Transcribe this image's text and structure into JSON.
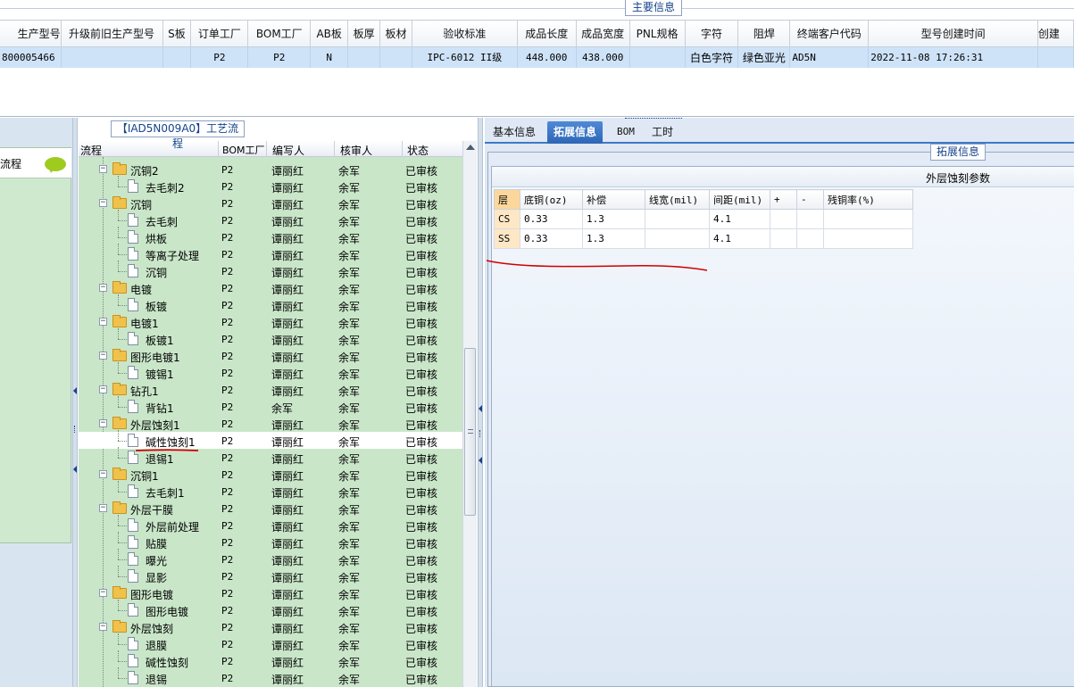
{
  "main_info": {
    "title": "主要信息",
    "columns": [
      "生产型号",
      "升级前旧生产型号",
      "S板",
      "订单工厂",
      "BOM工厂",
      "AB板",
      "板厚",
      "板材",
      "验收标准",
      "成品长度",
      "成品宽度",
      "PNL规格",
      "字符",
      "阻焊",
      "终端客户代码",
      "型号创建时间",
      "创建"
    ],
    "row": [
      "800005466",
      "",
      "",
      "P2",
      "P2",
      "N",
      "",
      "",
      "IPC-6012 II级",
      "448.000",
      "438.000",
      "",
      "白色字符",
      "绿色亚光",
      "AD5N",
      "2022-11-08 17:26:31",
      ""
    ]
  },
  "left_sidebar": {
    "item_label": "流程"
  },
  "process_tree": {
    "title": "【IAD5N009A0】工艺流程",
    "headers": [
      "流程",
      "BOM工厂",
      "编写人",
      "核审人",
      "状态"
    ],
    "rows": [
      {
        "label": "沉铜2",
        "type": "folder",
        "bom": "P2",
        "writer": "谭丽红",
        "reviewer": "余军",
        "status": "已审核"
      },
      {
        "label": "去毛刺2",
        "type": "doc",
        "bom": "P2",
        "writer": "谭丽红",
        "reviewer": "余军",
        "status": "已审核"
      },
      {
        "label": "沉铜",
        "type": "folder",
        "bom": "P2",
        "writer": "谭丽红",
        "reviewer": "余军",
        "status": "已审核"
      },
      {
        "label": "去毛刺",
        "type": "doc",
        "bom": "P2",
        "writer": "谭丽红",
        "reviewer": "余军",
        "status": "已审核"
      },
      {
        "label": "烘板",
        "type": "doc",
        "bom": "P2",
        "writer": "谭丽红",
        "reviewer": "余军",
        "status": "已审核"
      },
      {
        "label": "等离子处理",
        "type": "doc",
        "bom": "P2",
        "writer": "谭丽红",
        "reviewer": "余军",
        "status": "已审核"
      },
      {
        "label": "沉铜",
        "type": "doc",
        "bom": "P2",
        "writer": "谭丽红",
        "reviewer": "余军",
        "status": "已审核"
      },
      {
        "label": "电镀",
        "type": "folder",
        "bom": "P2",
        "writer": "谭丽红",
        "reviewer": "余军",
        "status": "已审核"
      },
      {
        "label": "板镀",
        "type": "doc",
        "bom": "P2",
        "writer": "谭丽红",
        "reviewer": "余军",
        "status": "已审核"
      },
      {
        "label": "电镀1",
        "type": "folder",
        "bom": "P2",
        "writer": "谭丽红",
        "reviewer": "余军",
        "status": "已审核"
      },
      {
        "label": "板镀1",
        "type": "doc",
        "bom": "P2",
        "writer": "谭丽红",
        "reviewer": "余军",
        "status": "已审核"
      },
      {
        "label": "图形电镀1",
        "type": "folder",
        "bom": "P2",
        "writer": "谭丽红",
        "reviewer": "余军",
        "status": "已审核"
      },
      {
        "label": "镀锡1",
        "type": "doc",
        "bom": "P2",
        "writer": "谭丽红",
        "reviewer": "余军",
        "status": "已审核"
      },
      {
        "label": "钻孔1",
        "type": "folder",
        "bom": "P2",
        "writer": "谭丽红",
        "reviewer": "余军",
        "status": "已审核"
      },
      {
        "label": "背钻1",
        "type": "doc",
        "bom": "P2",
        "writer": "余军",
        "reviewer": "余军",
        "status": "已审核"
      },
      {
        "label": "外层蚀刻1",
        "type": "folder",
        "bom": "P2",
        "writer": "谭丽红",
        "reviewer": "余军",
        "status": "已审核"
      },
      {
        "label": "碱性蚀刻1",
        "type": "doc",
        "bom": "P2",
        "writer": "谭丽红",
        "reviewer": "余军",
        "status": "已审核",
        "selected": true
      },
      {
        "label": "退锡1",
        "type": "doc",
        "bom": "P2",
        "writer": "谭丽红",
        "reviewer": "余军",
        "status": "已审核"
      },
      {
        "label": "沉铜1",
        "type": "folder",
        "bom": "P2",
        "writer": "谭丽红",
        "reviewer": "余军",
        "status": "已审核"
      },
      {
        "label": "去毛刺1",
        "type": "doc",
        "bom": "P2",
        "writer": "谭丽红",
        "reviewer": "余军",
        "status": "已审核"
      },
      {
        "label": "外层干膜",
        "type": "folder",
        "bom": "P2",
        "writer": "谭丽红",
        "reviewer": "余军",
        "status": "已审核"
      },
      {
        "label": "外层前处理",
        "type": "doc",
        "bom": "P2",
        "writer": "谭丽红",
        "reviewer": "余军",
        "status": "已审核"
      },
      {
        "label": "贴膜",
        "type": "doc",
        "bom": "P2",
        "writer": "谭丽红",
        "reviewer": "余军",
        "status": "已审核"
      },
      {
        "label": "曝光",
        "type": "doc",
        "bom": "P2",
        "writer": "谭丽红",
        "reviewer": "余军",
        "status": "已审核"
      },
      {
        "label": "显影",
        "type": "doc",
        "bom": "P2",
        "writer": "谭丽红",
        "reviewer": "余军",
        "status": "已审核"
      },
      {
        "label": "图形电镀",
        "type": "folder",
        "bom": "P2",
        "writer": "谭丽红",
        "reviewer": "余军",
        "status": "已审核"
      },
      {
        "label": "图形电镀",
        "type": "doc",
        "bom": "P2",
        "writer": "谭丽红",
        "reviewer": "余军",
        "status": "已审核"
      },
      {
        "label": "外层蚀刻",
        "type": "folder",
        "bom": "P2",
        "writer": "谭丽红",
        "reviewer": "余军",
        "status": "已审核"
      },
      {
        "label": "退膜",
        "type": "doc",
        "bom": "P2",
        "writer": "谭丽红",
        "reviewer": "余军",
        "status": "已审核"
      },
      {
        "label": "碱性蚀刻",
        "type": "doc",
        "bom": "P2",
        "writer": "谭丽红",
        "reviewer": "余军",
        "status": "已审核"
      },
      {
        "label": "退锡",
        "type": "doc",
        "bom": "P2",
        "writer": "谭丽红",
        "reviewer": "余军",
        "status": "已审核"
      }
    ]
  },
  "right_panel": {
    "tabs": [
      "基本信息",
      "拓展信息",
      "BOM",
      "工时"
    ],
    "active_tab": "拓展信息",
    "ext_title": "拓展信息",
    "table_caption": "外层蚀刻参数",
    "param_headers": [
      "层",
      "底铜(oz)",
      "补偿",
      "线宽(mil)",
      "间距(mil)",
      "+",
      "-",
      "残铜率(%)"
    ],
    "param_rows": [
      [
        "CS",
        "0.33",
        "1.3",
        "",
        "4.1",
        "",
        "",
        ""
      ],
      [
        "SS",
        "0.33",
        "1.3",
        "",
        "4.1",
        "",
        "",
        ""
      ]
    ]
  },
  "colors": {
    "selection_blue": "#cfe3f8",
    "tree_green": "#c9e6c9",
    "active_tab": "#2e66b6",
    "annotation_red": "#d00000"
  }
}
